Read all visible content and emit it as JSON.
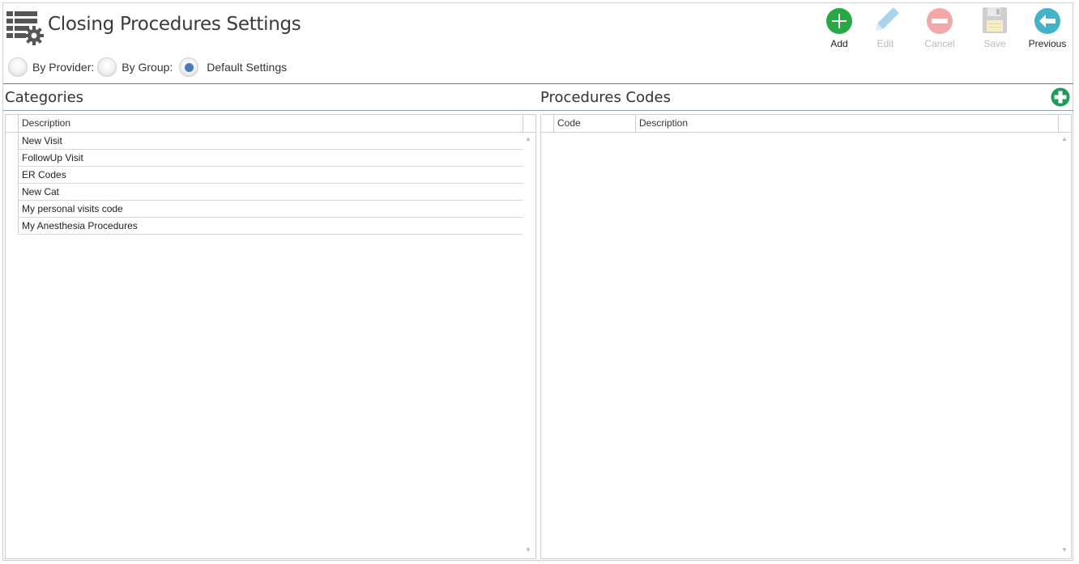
{
  "header": {
    "title": "Closing Procedures Settings"
  },
  "radios": [
    {
      "label": "By Provider:",
      "checked": false
    },
    {
      "label": "By Group:",
      "checked": false
    },
    {
      "label": "Default Settings",
      "checked": true
    }
  ],
  "toolbar": {
    "add_label": "Add",
    "edit_label": "Edit",
    "cancel_label": "Cancel",
    "save_label": "Save",
    "previous_label": "Previous"
  },
  "categories": {
    "title": "Categories",
    "columns": [
      "Description"
    ],
    "rows": [
      "New Visit",
      "FollowUp Visit",
      "ER Codes",
      "New Cat",
      "My personal visits code",
      "My Anesthesia Procedures"
    ]
  },
  "procedures": {
    "title": "Procedures Codes",
    "columns": [
      "Code",
      "Description"
    ],
    "rows": []
  },
  "colors": {
    "add_green": "#27a845",
    "edit_blue": "#9ccbe8",
    "cancel_red": "#f2a3a3",
    "previous_teal": "#43b3c9",
    "radio_selected": "#4a78b8",
    "divider": "#5f7f93"
  }
}
